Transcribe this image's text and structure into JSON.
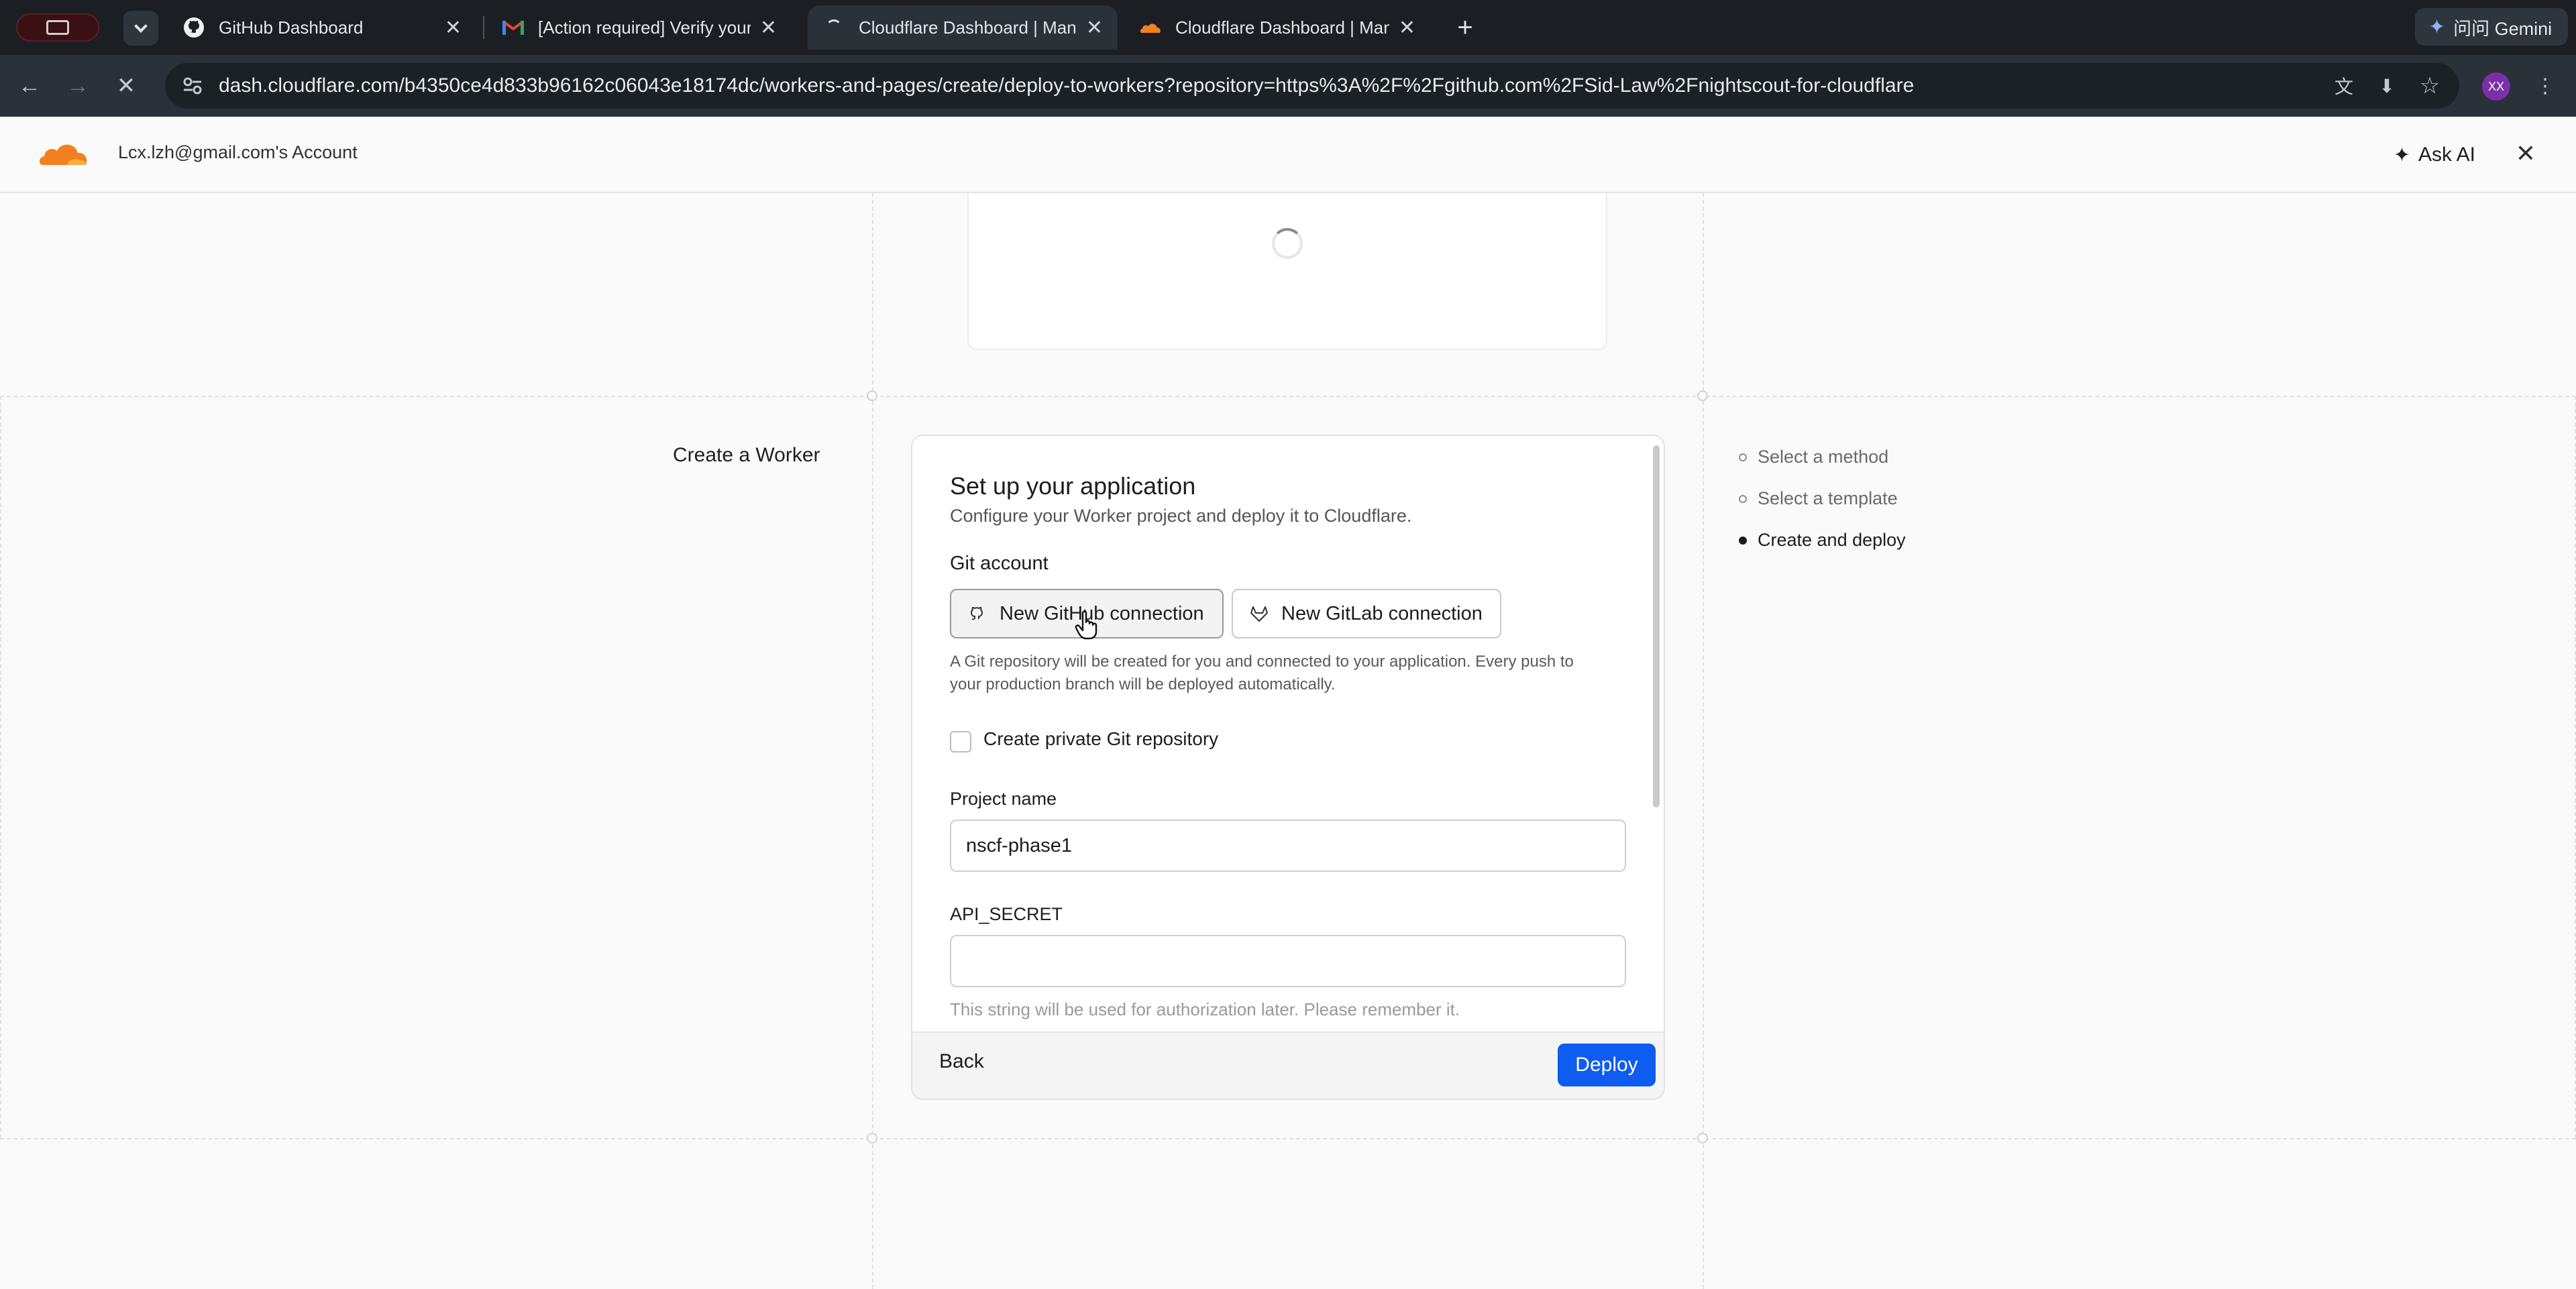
{
  "browser": {
    "tabs": [
      {
        "title": "GitHub Dashboard",
        "icon": "github-icon"
      },
      {
        "title": "[Action required] Verify your",
        "icon": "gmail-icon"
      },
      {
        "title": "Cloudflare Dashboard | Mana",
        "icon": "loading-icon"
      },
      {
        "title": "Cloudflare Dashboard | Mana",
        "icon": "cloudflare-icon"
      }
    ],
    "active_tab": 2,
    "url": "dash.cloudflare.com/b4350ce4d833b96162c06043e18174dc/workers-and-pages/create/deploy-to-workers?repository=https%3A%2F%2Fgithub.com%2FSid-Law%2Fnightscout-for-cloudflare",
    "profile_initials": "XX",
    "gemini_label": "问问 Gemini"
  },
  "header": {
    "account": "Lcx.lzh@gmail.com's Account",
    "ask_ai": "Ask AI"
  },
  "page": {
    "section_title": "Create a Worker"
  },
  "form": {
    "title": "Set up your application",
    "subtitle": "Configure your Worker project and deploy it to Cloudflare.",
    "git_account_label": "Git account",
    "github_button": "New GitHub connection",
    "gitlab_button": "New GitLab connection",
    "git_help_line1": "A Git repository will be created for you and connected to your application. Every push to",
    "git_help_line2": "your production branch will be deployed automatically.",
    "private_repo_label": "Create private Git repository",
    "project_name_label": "Project name",
    "project_name_value": "nscf-phase1",
    "api_secret_label": "API_SECRET",
    "api_secret_value": "",
    "api_secret_help": "This string will be used for authorization later. Please remember it.",
    "back_button": "Back",
    "deploy_button": "Deploy"
  },
  "steps": [
    {
      "label": "Select a method",
      "current": false
    },
    {
      "label": "Select a template",
      "current": false
    },
    {
      "label": "Create and deploy",
      "current": true
    }
  ],
  "colors": {
    "deploy": "#0f5cf0",
    "cloudflare_orange": "#f38020"
  }
}
